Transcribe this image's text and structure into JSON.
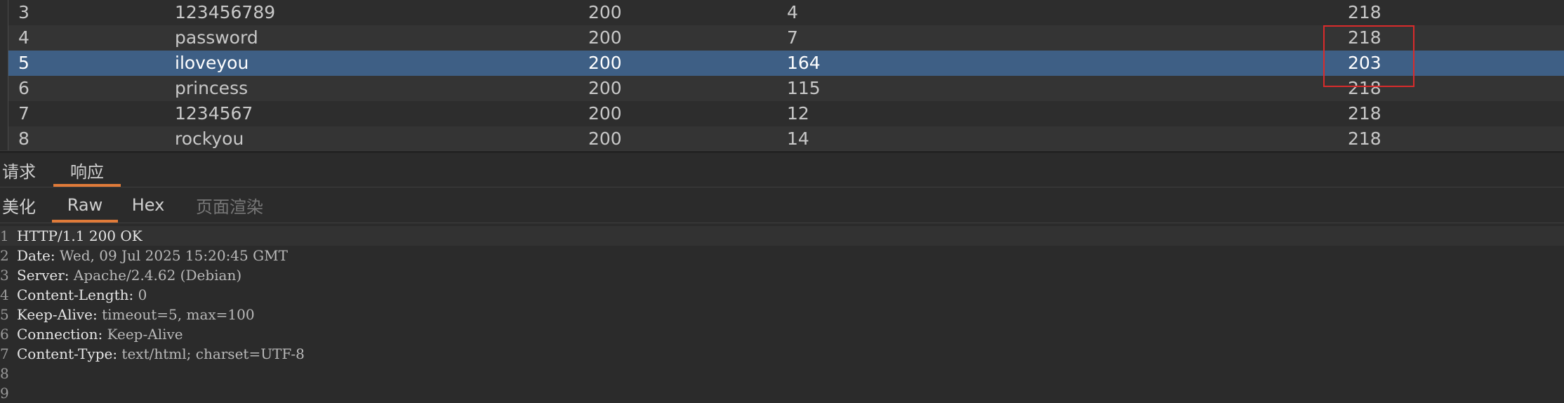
{
  "results": {
    "rows": [
      {
        "num": "3",
        "payload": "123456789",
        "status": "200",
        "time": "4",
        "length": "218"
      },
      {
        "num": "4",
        "payload": "password",
        "status": "200",
        "time": "7",
        "length": "218"
      },
      {
        "num": "5",
        "payload": "iloveyou",
        "status": "200",
        "time": "164",
        "length": "203"
      },
      {
        "num": "6",
        "payload": "princess",
        "status": "200",
        "time": "115",
        "length": "218"
      },
      {
        "num": "7",
        "payload": "1234567",
        "status": "200",
        "time": "12",
        "length": "218"
      },
      {
        "num": "8",
        "payload": "rockyou",
        "status": "200",
        "time": "14",
        "length": "218"
      }
    ],
    "selected_row_index": 2,
    "highlight_color": "#d92b2b",
    "selection_color": "#3e5f85"
  },
  "panel_tabs": [
    {
      "label": "请求"
    },
    {
      "label": "响应"
    }
  ],
  "view_tabs": [
    {
      "label": "美化"
    },
    {
      "label": "Raw"
    },
    {
      "label": "Hex"
    },
    {
      "label": "页面渲染"
    }
  ],
  "response": {
    "lines": [
      {
        "num": "1",
        "key": "HTTP/1.1 200 OK",
        "value": ""
      },
      {
        "num": "2",
        "key": "Date:",
        "value": " Wed, 09 Jul 2025 15:20:45 GMT"
      },
      {
        "num": "3",
        "key": "Server:",
        "value": " Apache/2.4.62 (Debian)"
      },
      {
        "num": "4",
        "key": "Content-Length:",
        "value": " 0"
      },
      {
        "num": "5",
        "key": "Keep-Alive:",
        "value": " timeout=5, max=100"
      },
      {
        "num": "6",
        "key": "Connection:",
        "value": " Keep-Alive"
      },
      {
        "num": "7",
        "key": "Content-Type:",
        "value": " text/html; charset=UTF-8"
      },
      {
        "num": "8",
        "key": "",
        "value": ""
      },
      {
        "num": "9",
        "key": "",
        "value": ""
      }
    ]
  },
  "accent_color": "#e07b39"
}
